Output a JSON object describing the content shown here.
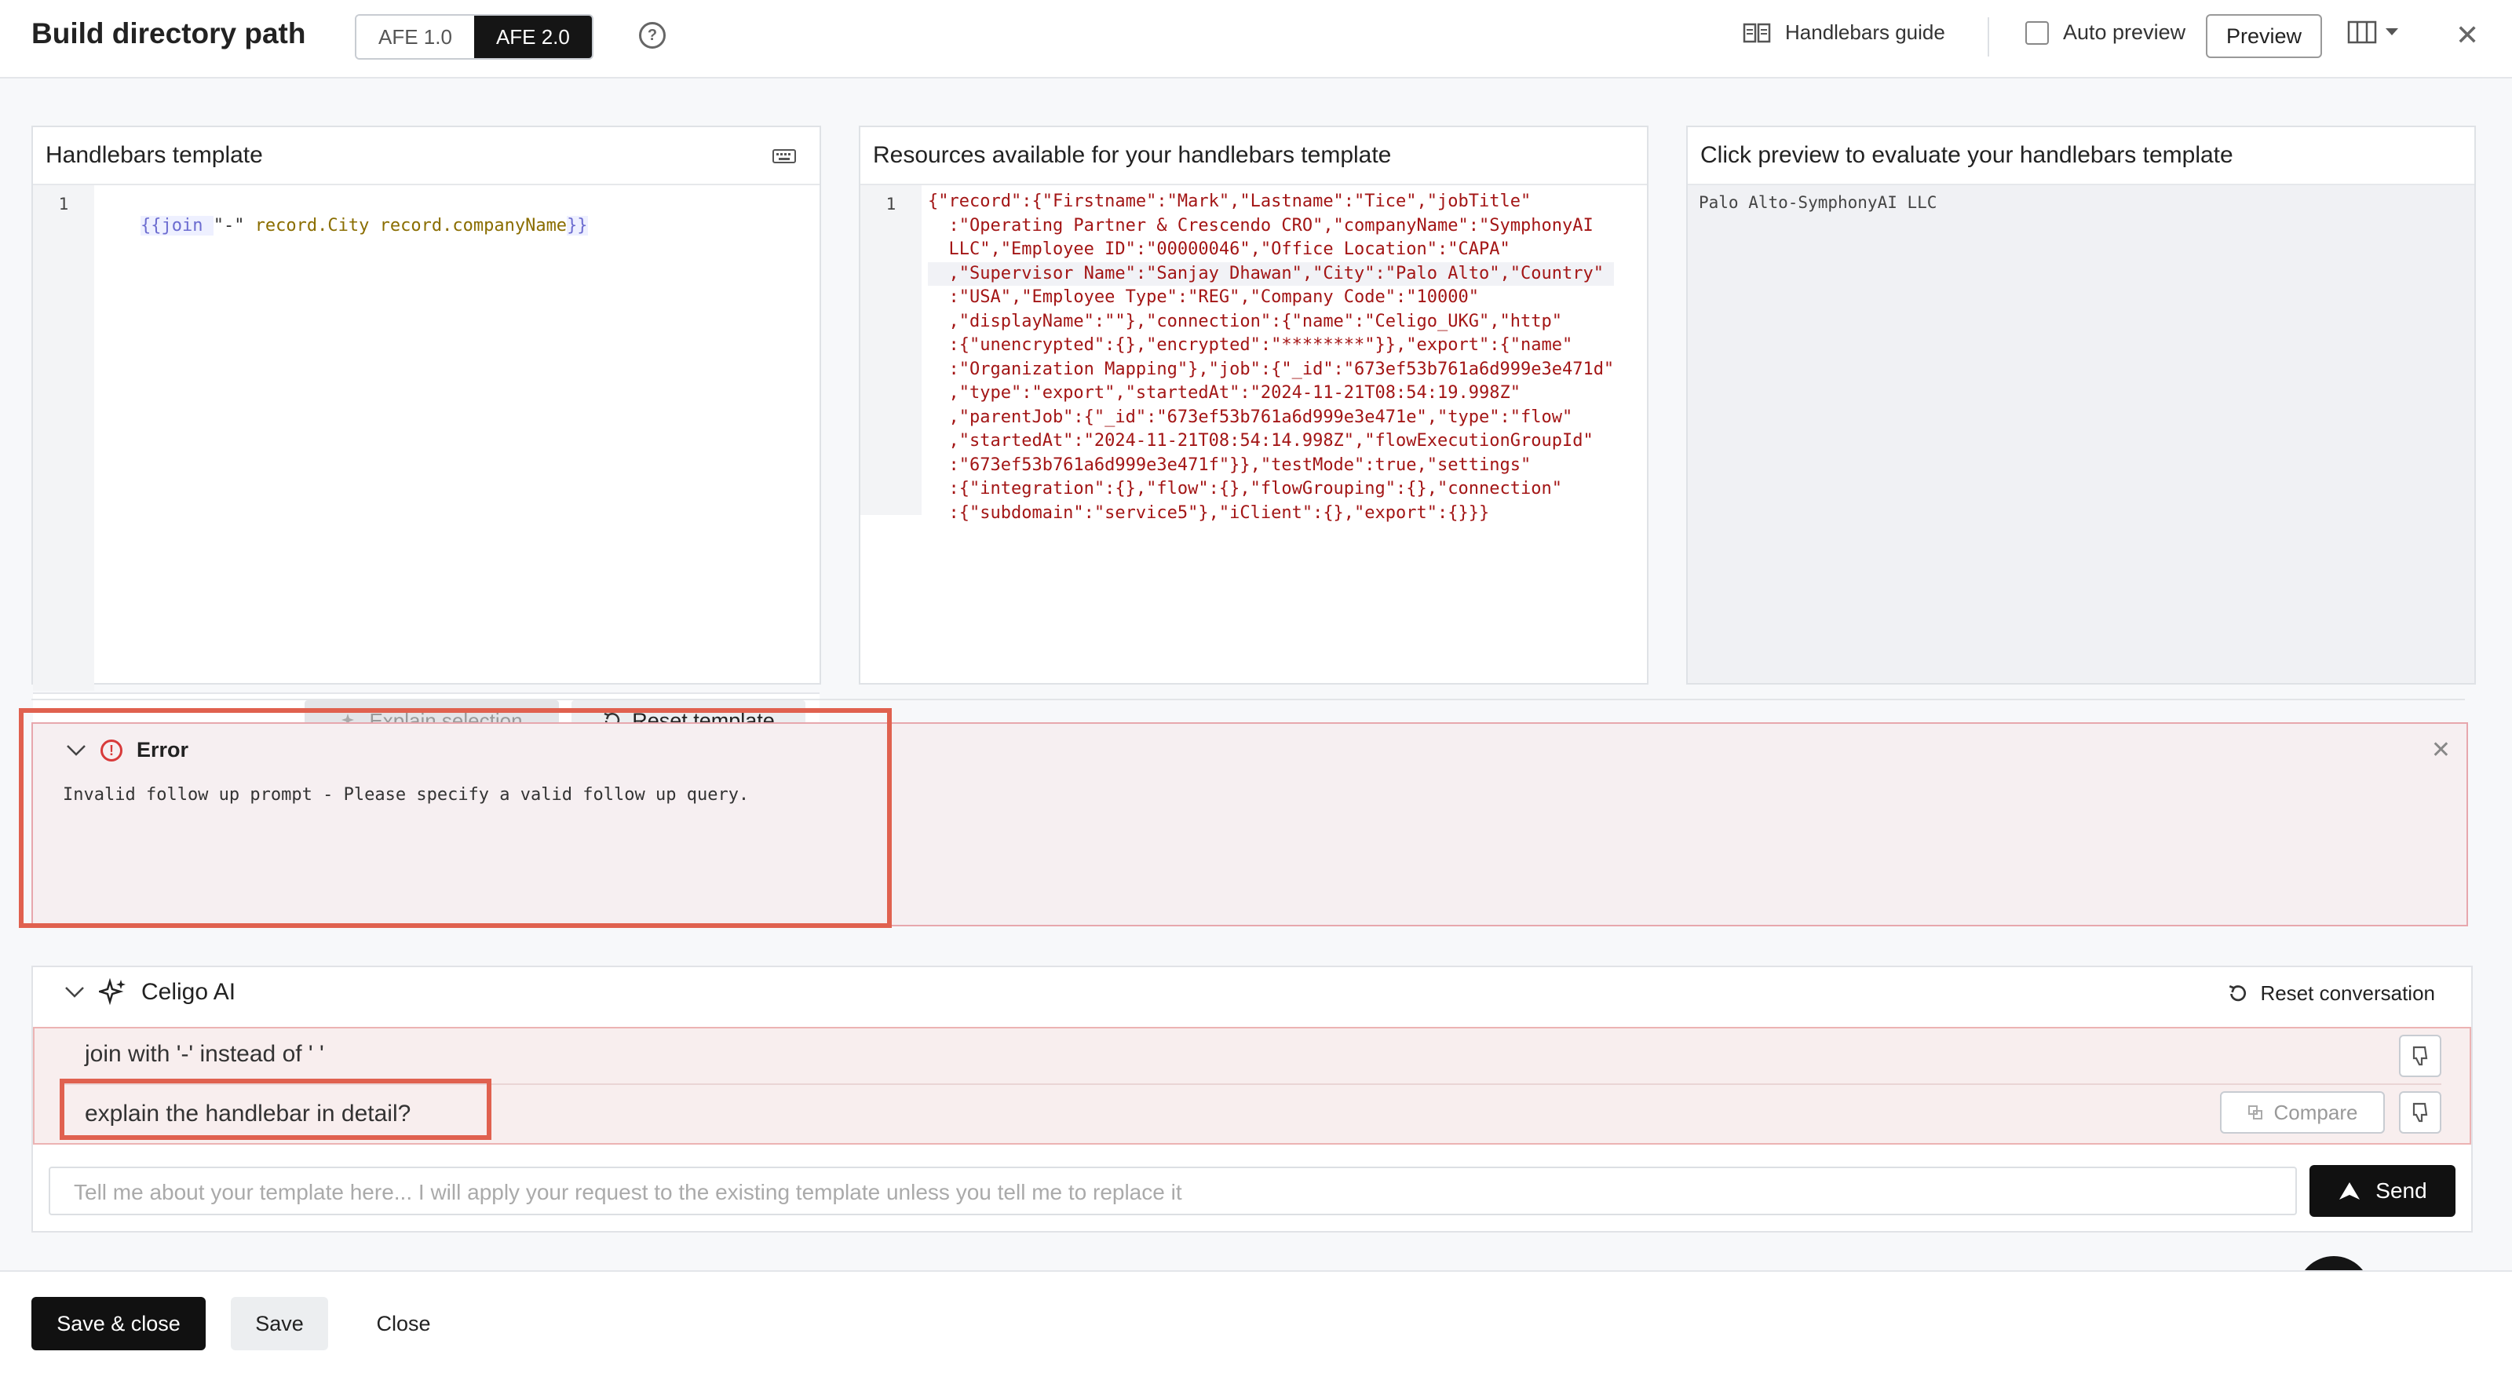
{
  "header": {
    "title": "Build directory path",
    "afe_options": [
      "AFE 1.0",
      "AFE 2.0"
    ],
    "afe_selected": "AFE 2.0",
    "help_icon": "question-circle-icon",
    "guide_label": "Handlebars guide",
    "auto_preview_label": "Auto preview",
    "auto_preview_checked": false,
    "preview_label": "Preview"
  },
  "panels": {
    "template": {
      "title": "Handlebars template",
      "line": "1",
      "code_open": "{{join ",
      "code_sep": "\"-\" ",
      "code_arg1": "record.City ",
      "code_arg2": "record.companyName",
      "code_close": "}}",
      "explain_label": "Explain selection",
      "reset_label": "Reset template"
    },
    "resources": {
      "title": "Resources available for your handlebars template",
      "line": "1",
      "lines": [
        "{\"record\":{\"Firstname\":\"Mark\",\"Lastname\":\"Tice\",\"jobTitle\"",
        "  :\"Operating Partner & Crescendo CRO\",\"companyName\":\"SymphonyAI",
        "  LLC\",\"Employee ID\":\"00000046\",\"Office Location\":\"CAPA\"",
        "  ,\"Supervisor Name\":\"Sanjay Dhawan\",\"City\":\"Palo Alto\",\"Country\"",
        "  :\"USA\",\"Employee Type\":\"REG\",\"Company Code\":\"10000\"",
        "  ,\"displayName\":\"\"},\"connection\":{\"name\":\"Celigo_UKG\",\"http\"",
        "  :{\"unencrypted\":{},\"encrypted\":\"********\"}},\"export\":{\"name\"",
        "  :\"Organization Mapping\"},\"job\":{\"_id\":\"673ef53b761a6d999e3e471d\"",
        "  ,\"type\":\"export\",\"startedAt\":\"2024-11-21T08:54:19.998Z\"",
        "  ,\"parentJob\":{\"_id\":\"673ef53b761a6d999e3e471e\",\"type\":\"flow\"",
        "  ,\"startedAt\":\"2024-11-21T08:54:14.998Z\",\"flowExecutionGroupId\"",
        "  :\"673ef53b761a6d999e3e471f\"}},\"testMode\":true,\"settings\"",
        "  :{\"integration\":{},\"flow\":{},\"flowGrouping\":{},\"connection\"",
        "  :{\"subdomain\":\"service5\"},\"iClient\":{},\"export\":{}}}"
      ]
    },
    "preview": {
      "title": "Click preview to evaluate your handlebars template",
      "result": "Palo Alto-SymphonyAI LLC"
    }
  },
  "error": {
    "title": "Error",
    "message": "Invalid follow up prompt - Please specify a valid follow up query."
  },
  "ai": {
    "title": "Celigo AI",
    "reset_label": "Reset conversation",
    "messages": [
      "join with '-' instead of ' '",
      "explain the handlebar in detail?"
    ],
    "compare_label": "Compare",
    "input_placeholder": "Tell me about your template here... I will apply your request to the existing template unless you tell me to replace it",
    "send_label": "Send"
  },
  "footer": {
    "save_close": "Save & close",
    "save": "Save",
    "close": "Close"
  },
  "colors": {
    "accent_dark": "#151515",
    "error_red": "#d83a3a",
    "highlight_box": "#e0614f"
  }
}
